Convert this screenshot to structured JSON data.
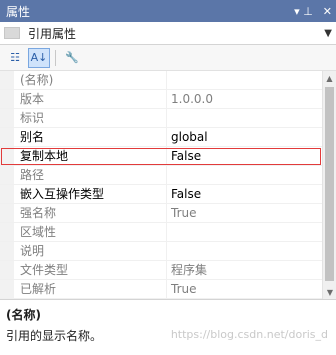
{
  "panel": {
    "title": "属性",
    "pin_glyph": "▾ ⊥",
    "close_glyph": "✕"
  },
  "selector": {
    "label": "引用属性",
    "dropdown_glyph": "▼"
  },
  "toolbar": {
    "categorized_glyph": "☷",
    "alphabetical_glyph": "A↓",
    "property_pages_glyph": "🔧"
  },
  "properties": [
    {
      "name": "(名称)",
      "value": "",
      "dim": true
    },
    {
      "name": "版本",
      "value": "1.0.0.0",
      "dim": true
    },
    {
      "name": "标识",
      "value": "",
      "dim": true
    },
    {
      "name": "别名",
      "value": "global",
      "dim": false
    },
    {
      "name": "复制本地",
      "value": "False",
      "dim": false,
      "highlight": true
    },
    {
      "name": "路径",
      "value": "",
      "dim": true
    },
    {
      "name": "嵌入互操作类型",
      "value": "False",
      "dim": false
    },
    {
      "name": "强名称",
      "value": "True",
      "dim": true
    },
    {
      "name": "区域性",
      "value": "",
      "dim": true
    },
    {
      "name": "说明",
      "value": "",
      "dim": true
    },
    {
      "name": "文件类型",
      "value": "程序集",
      "dim": true
    },
    {
      "name": "已解析",
      "value": "True",
      "dim": true
    }
  ],
  "description": {
    "name": "(名称)",
    "text": "引用的显示名称。"
  },
  "watermark": "https://blog.csdn.net/doris_d"
}
